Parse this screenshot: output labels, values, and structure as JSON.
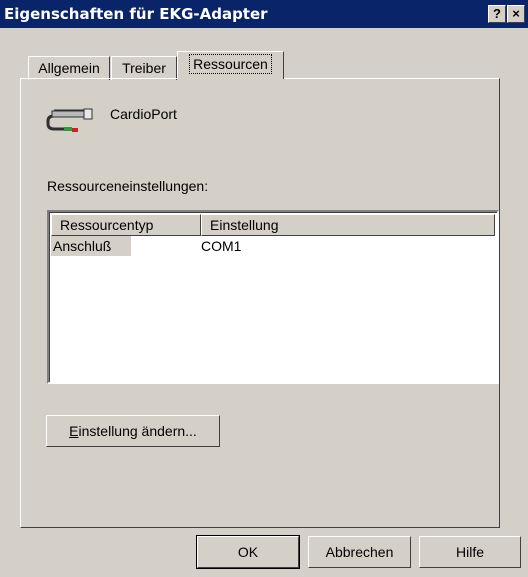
{
  "window": {
    "title": "Eigenschaften für EKG-Adapter",
    "help_glyph": "?",
    "close_glyph": "×"
  },
  "tabs": [
    {
      "label": "Allgemein"
    },
    {
      "label": "Treiber"
    },
    {
      "label": "Ressourcen"
    }
  ],
  "device": {
    "name": "CardioPort",
    "icon": "serial-cable-icon"
  },
  "resources": {
    "label": "Ressourceneinstellungen:",
    "columns": [
      "Ressourcentyp",
      "Einstellung"
    ],
    "rows": [
      {
        "type": "Anschluß",
        "setting": "COM1"
      }
    ]
  },
  "change_button": {
    "accel": "E",
    "rest": "instellung ändern..."
  },
  "buttons": {
    "ok": "OK",
    "cancel": "Abbrechen",
    "help": "Hilfe"
  },
  "colors": {
    "titlebar": "#0a246a",
    "face": "#d4d0c8",
    "highlight": "#d4d0c8"
  }
}
